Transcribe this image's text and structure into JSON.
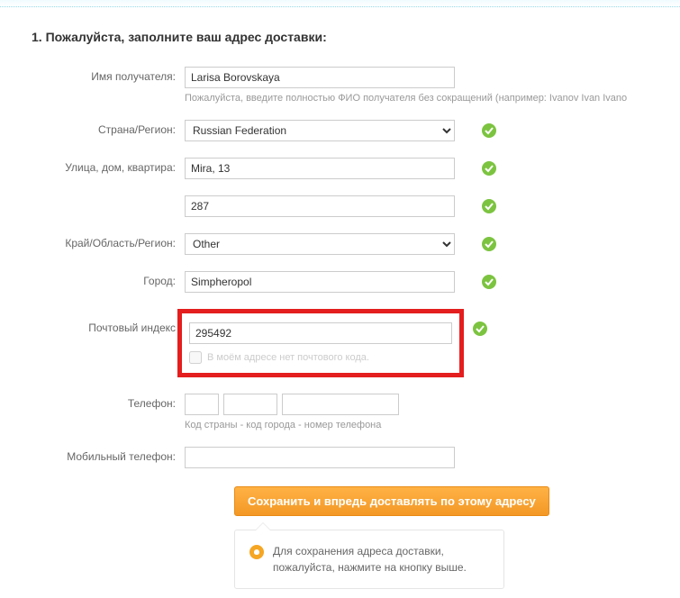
{
  "heading": "1. Пожалуйста, заполните ваш адрес доставки:",
  "fields": {
    "recipient": {
      "label": "Имя получателя:",
      "value": "Larisa Borovskaya",
      "hint": "Пожалуйста, введите полностью ФИО получателя без сокращений (например: Ivanov Ivan Ivanо"
    },
    "country": {
      "label": "Страна/Регион:",
      "value": "Russian Federation"
    },
    "street": {
      "label": "Улица, дом, квартира:",
      "value": "Mira, 13"
    },
    "street2": {
      "value": "287"
    },
    "region": {
      "label": "Край/Область/Регион:",
      "value": "Other"
    },
    "city": {
      "label": "Город:",
      "value": "Simpheropol"
    },
    "postal": {
      "label": "Почтовый индекс",
      "value": "295492",
      "nopostal_label": "В моём адресе нет почтового кода."
    },
    "phone": {
      "label": "Телефон:",
      "hint": "Код страны - код города - номер телефона"
    },
    "mobile": {
      "label": "Мобильный телефон:"
    }
  },
  "submit_label": "Сохранить и впредь доставлять по этому адресу",
  "callout": {
    "line1": "Для сохранения адреса доставки,",
    "line2": "пожалуйста, нажмите на кнопку выше."
  }
}
